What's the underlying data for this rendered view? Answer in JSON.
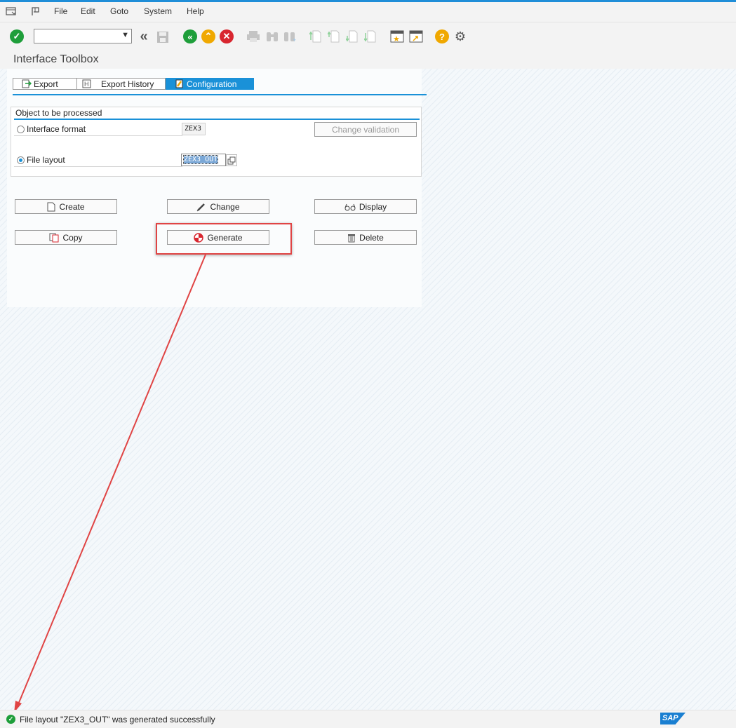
{
  "menu": {
    "file": "File",
    "edit": "Edit",
    "goto": "Goto",
    "system": "System",
    "help": "Help"
  },
  "colors": {
    "accent": "#1a91d8",
    "highlight": "#e04444",
    "ok": "#1e9e3a",
    "cancel": "#d8262f",
    "up": "#f0a800"
  },
  "page_title": "Interface Toolbox",
  "tabs": [
    {
      "label": "Export",
      "icon": "export-icon"
    },
    {
      "label": "Export History",
      "icon": "history-icon"
    },
    {
      "label": "Configuration",
      "icon": "configuration-icon",
      "active": true
    }
  ],
  "group": {
    "title": "Object to be processed",
    "interface_format": {
      "label": "Interface format",
      "value": "ZEX3",
      "selected": false
    },
    "file_layout": {
      "label": "File layout",
      "value": "ZEX3_OUT",
      "selected": true
    },
    "change_validation": "Change validation"
  },
  "buttons": {
    "create": "Create",
    "change": "Change",
    "display": "Display",
    "copy": "Copy",
    "generate": "Generate",
    "delete": "Delete"
  },
  "status": {
    "message": "File layout \"ZEX3_OUT\" was generated successfully",
    "logo": "SAP"
  }
}
